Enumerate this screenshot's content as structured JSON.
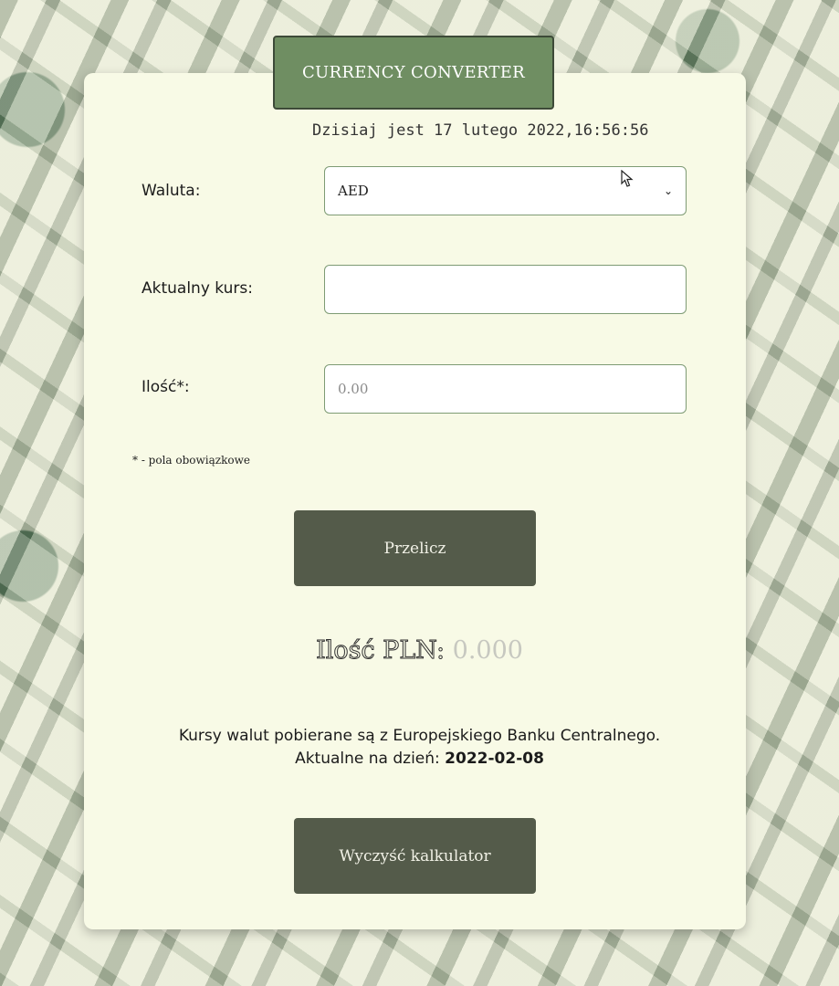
{
  "app": {
    "title": "CURRENCY CONVERTER",
    "datetime": "Dzisiaj jest 17 lutego 2022,16:56:56"
  },
  "form": {
    "currency_label": "Waluta:",
    "currency_value": "AED",
    "currency_chevron": "⌄",
    "rate_label": "Aktualny kurs:",
    "rate_value": "",
    "amount_label": "Ilość*:",
    "amount_placeholder": "0.00",
    "required_note": "* - pola obowiązkowe"
  },
  "buttons": {
    "convert_label": "Przelicz",
    "clear_label": "Wyczyść kalkulator"
  },
  "result": {
    "label": "Ilość PLN:",
    "value": "0.000"
  },
  "info": {
    "line1": "Kursy walut pobierane są z Europejskiego Banku Centralnego.",
    "line2_prefix": "Aktualne na dzień:",
    "date": "2022-02-08"
  },
  "colors": {
    "accent": "#6f8e62",
    "button": "#545b4a",
    "card": "#f8fae6"
  },
  "icons": {
    "cursor": "mouse-pointer-icon",
    "dropdown": "chevron-down-icon"
  }
}
